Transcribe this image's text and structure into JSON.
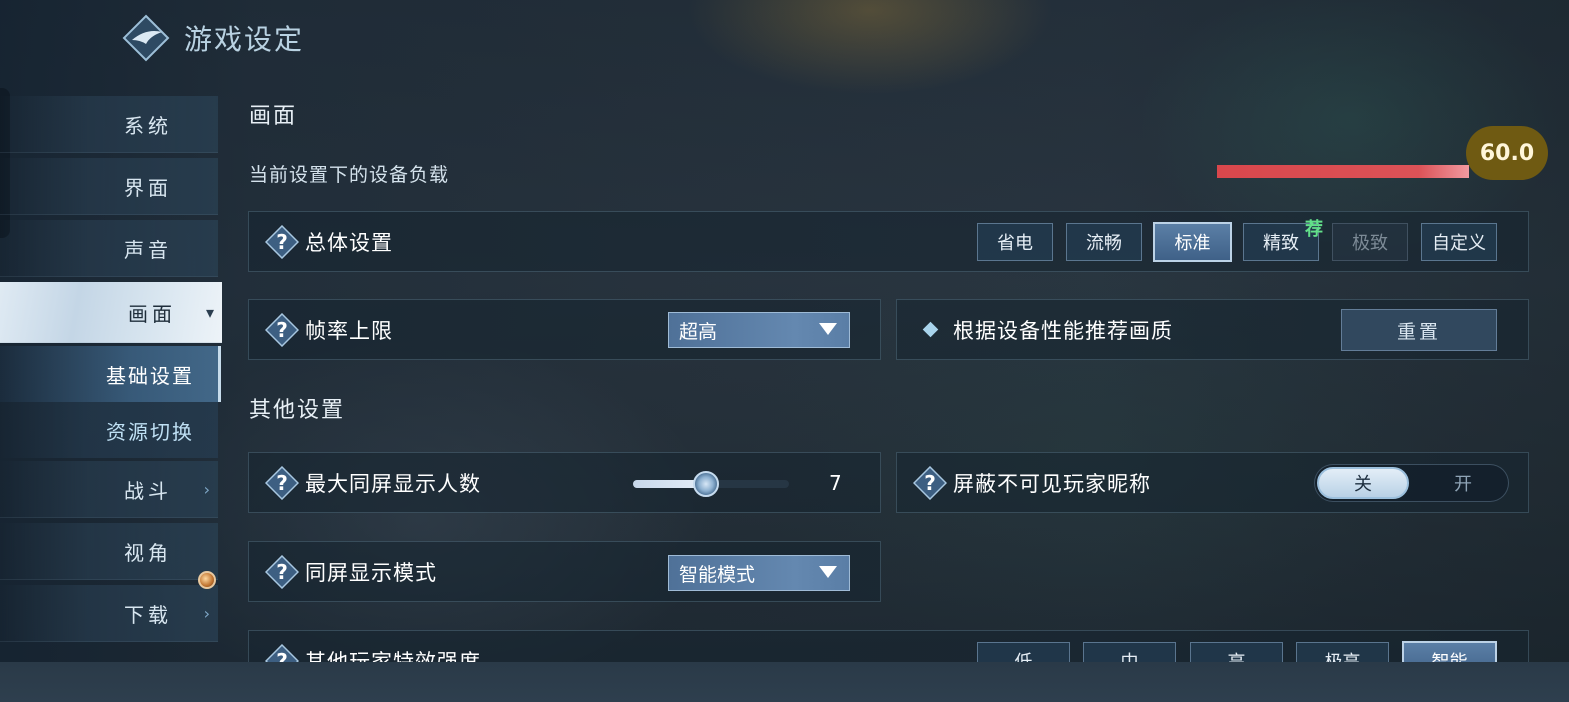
{
  "header": {
    "title": "游戏设定",
    "logo_icon": "diamond-wing-emblem"
  },
  "sidebar": {
    "items": [
      {
        "label": "系统",
        "chevron": ""
      },
      {
        "label": "界面",
        "chevron": ""
      },
      {
        "label": "声音",
        "chevron": ""
      },
      {
        "label": "画面",
        "chevron": "▾",
        "active": true
      },
      {
        "label": "战斗",
        "chevron": "›"
      },
      {
        "label": "视角",
        "chevron": ""
      },
      {
        "label": "下载",
        "chevron": "›",
        "badge": true
      }
    ],
    "sub_items": [
      {
        "label": "基础设置",
        "active": true
      },
      {
        "label": "资源切换",
        "active": false
      }
    ]
  },
  "main": {
    "section_graphics": "画面",
    "device_load": {
      "label": "当前设置下的设备负载",
      "value": "60.0",
      "fill_fraction": 1.0,
      "color": "#d9474c"
    },
    "overall": {
      "label": "总体设置",
      "options": [
        "省电",
        "流畅",
        "标准",
        "精致",
        "极致",
        "自定义"
      ],
      "selected": "标准",
      "disabled": "极致",
      "recommend_tag": "荐"
    },
    "framerate": {
      "label": "帧率上限",
      "value": "超高"
    },
    "recommend_quality": {
      "label": "根据设备性能推荐画质",
      "button": "重置"
    },
    "section_other": "其他设置",
    "max_players": {
      "label": "最大同屏显示人数",
      "value": "7",
      "fill_fraction": 0.47
    },
    "hide_names": {
      "label": "屏蔽不可见玩家昵称",
      "off_label": "关",
      "on_label": "开",
      "state": "off"
    },
    "display_mode": {
      "label": "同屏显示模式",
      "value": "智能模式"
    },
    "effects": {
      "label": "其他玩家特效强度",
      "options": [
        "低",
        "中",
        "高",
        "极高",
        "智能"
      ],
      "selected": "智能"
    }
  },
  "colors": {
    "accent": "#5b7fa6",
    "load_bar": "#d9474c",
    "load_badge": "#6f5a12",
    "recommend": "#62e08a"
  }
}
